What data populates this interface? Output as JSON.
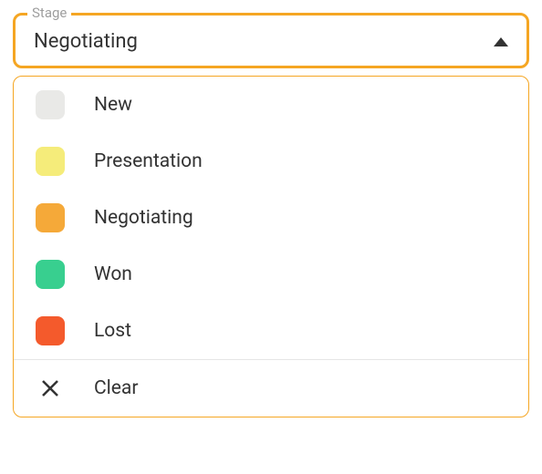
{
  "field": {
    "label": "Stage",
    "selected": "Negotiating"
  },
  "options": [
    {
      "label": "New",
      "color": "#e9e9e7"
    },
    {
      "label": "Presentation",
      "color": "#f5ec7a"
    },
    {
      "label": "Negotiating",
      "color": "#f5a939"
    },
    {
      "label": "Won",
      "color": "#38cf8f"
    },
    {
      "label": "Lost",
      "color": "#f45a2c"
    }
  ],
  "clear": {
    "label": "Clear"
  }
}
